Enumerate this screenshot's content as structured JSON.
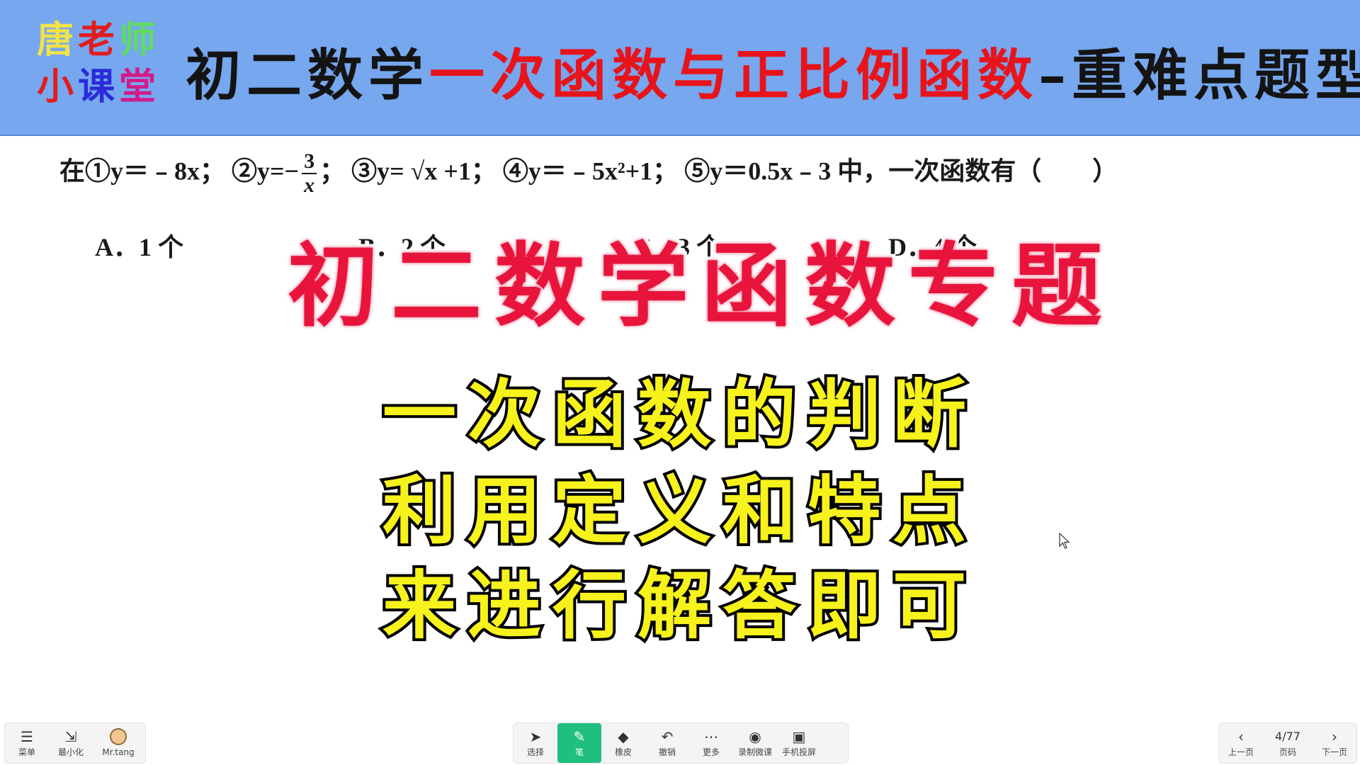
{
  "header": {
    "logo": {
      "line1": [
        "唐",
        "老",
        "师"
      ],
      "line2": [
        "小",
        "课",
        "堂"
      ]
    },
    "title_prefix": "初二数学",
    "title_highlight": "一次函数与正比例函数",
    "title_suffix": "–重难点题型"
  },
  "question": {
    "lead": "在",
    "item1": "①y＝﹣8x；",
    "item2_prefix": "②y=−",
    "item2_num": "3",
    "item2_den": "x",
    "item2_suffix": "；",
    "item3": "③y= √x +1；",
    "item4": "④y＝﹣5x²+1；",
    "item5": "⑤y＝0.5x﹣3 中，一次函数有（　　）",
    "options": {
      "a": "A．1 个",
      "b": "B．2 个",
      "c": "C．3 个",
      "d": "D．4 个"
    }
  },
  "overlay": {
    "title": "初二数学函数专题",
    "line1": "一次函数的判断",
    "line2": "利用定义和特点",
    "line3": "来进行解答即可"
  },
  "toolbar": {
    "left": {
      "menu": "菜单",
      "minimize": "最小化",
      "user": "Mr.tang"
    },
    "center": {
      "select": "选择",
      "pen": "笔",
      "eraser": "橡皮",
      "undo": "撤销",
      "more": "更多",
      "record": "录制微课",
      "phone": "手机投屏"
    },
    "right": {
      "prev": "上一页",
      "page": "4/77",
      "page_label": "页码",
      "next": "下一页"
    }
  },
  "colors": {
    "header_bg": "#76a7ef",
    "accent_red": "#e8141c",
    "caption_yellow": "#f7f21c",
    "active_tool": "#1fbf7f"
  }
}
